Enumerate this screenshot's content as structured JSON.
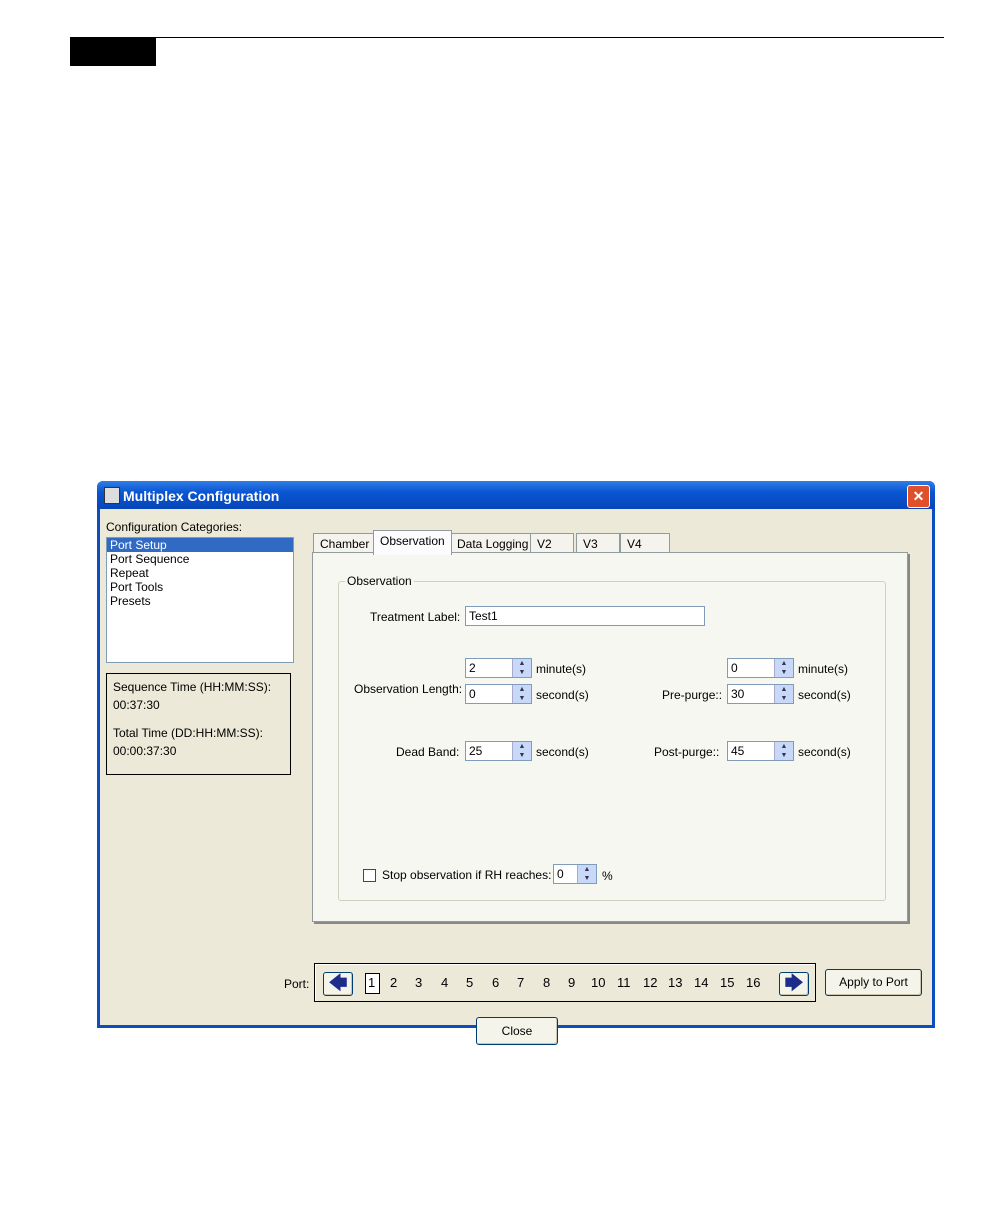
{
  "window": {
    "title": "Multiplex Configuration",
    "close_icon": "close-icon"
  },
  "sidebar": {
    "label": "Configuration Categories:",
    "items": [
      "Port Setup",
      "Port Sequence",
      "Repeat",
      "Port Tools",
      "Presets"
    ],
    "selected": "Port Setup"
  },
  "info": {
    "seq_label": "Sequence Time (HH:MM:SS):",
    "seq_value": "00:37:30",
    "total_label": "Total Time (DD:HH:MM:SS):",
    "total_value": "00:00:37:30"
  },
  "tabs": [
    "Chamber",
    "Observation",
    "Data Logging",
    "V2",
    "V3",
    "V4"
  ],
  "active_tab": "Observation",
  "group": {
    "title": "Observation",
    "treatment_label": "Treatment Label:",
    "treatment_value": "Test1",
    "obs_length_label": "Observation Length:",
    "obs_min": "2",
    "obs_sec": "0",
    "dead_band_label": "Dead Band:",
    "dead_band": "25",
    "prepurge_label": "Pre-purge::",
    "prepurge_min": "0",
    "prepurge_sec": "30",
    "postpurge_label": "Post-purge::",
    "postpurge_sec": "45",
    "minutes_unit": "minute(s)",
    "seconds_unit": "second(s)",
    "rh_label": "Stop observation if RH reaches:",
    "rh_value": "0",
    "rh_unit": "%",
    "rh_checked": false
  },
  "port": {
    "label": "Port:",
    "numbers": [
      "1",
      "2",
      "3",
      "4",
      "5",
      "6",
      "7",
      "8",
      "9",
      "10",
      "11",
      "12",
      "13",
      "14",
      "15",
      "16"
    ],
    "selected": "1"
  },
  "buttons": {
    "apply": "Apply to Port",
    "close": "Close"
  }
}
